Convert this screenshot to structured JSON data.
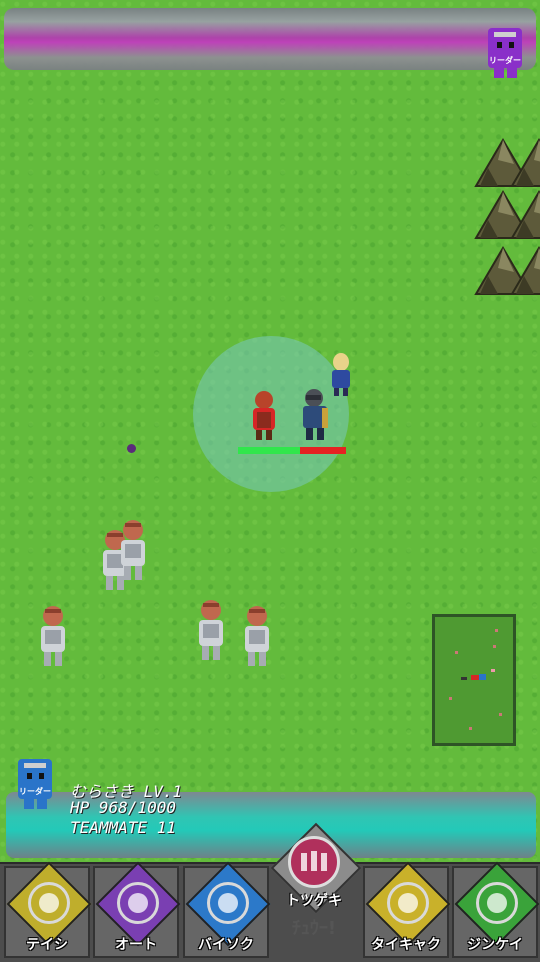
{
  "enemy": {
    "leader_label": "リーダー"
  },
  "player": {
    "leader_label": "リーダー",
    "name_level": "むらさき LV.1",
    "hp": "HP 968/1000",
    "teammate": "TEAMMATE 11"
  },
  "commands": [
    {
      "id": "teishi",
      "label": "テイシ",
      "color": "#bfae2c",
      "icon": "stop-icon"
    },
    {
      "id": "auto",
      "label": "オート",
      "color": "#7a3fb2",
      "icon": "auto-icon"
    },
    {
      "id": "baisoku",
      "label": "バイソク",
      "color": "#2c79c9",
      "icon": "speed-icon"
    },
    {
      "id": "taikyaku",
      "label": "タイキャク",
      "color": "#c9b12a",
      "icon": "retreat-icon"
    },
    {
      "id": "jinkei",
      "label": "ジンケイ",
      "color": "#3aa33a",
      "icon": "formation-icon"
    }
  ],
  "totsugeki": {
    "label": "トツゲキ",
    "sub": "ﾁｭｳｰ!",
    "color": "#b0305c",
    "icon": "charge-icon"
  },
  "colors": {
    "enemy": "#8a2fc9",
    "player": "#2a74c9",
    "hp_ok": "#31e64c",
    "hp_low": "#e52222"
  }
}
